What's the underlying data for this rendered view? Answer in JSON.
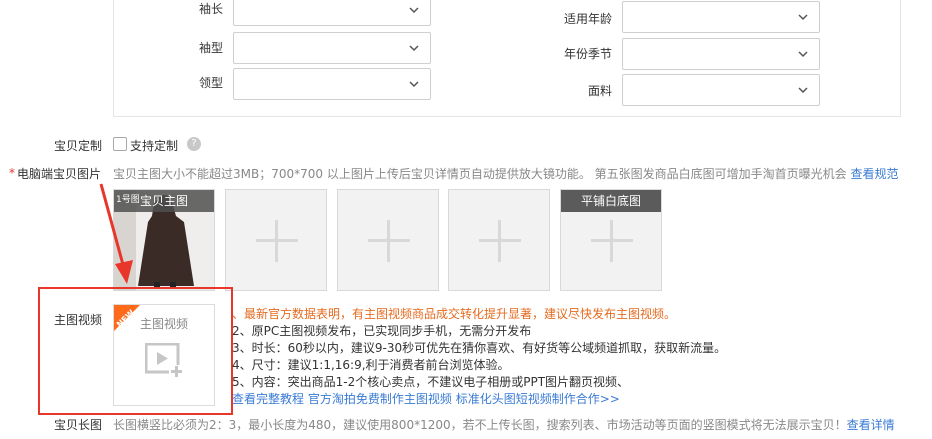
{
  "attributes": {
    "left": [
      {
        "label": "袖长",
        "value": ""
      },
      {
        "label": "袖型",
        "value": ""
      },
      {
        "label": "领型",
        "value": ""
      }
    ],
    "right": [
      {
        "label": "适用年龄",
        "value": ""
      },
      {
        "label": "年份季节",
        "value": ""
      },
      {
        "label": "面料",
        "value": ""
      }
    ]
  },
  "customize": {
    "label": "宝贝定制",
    "checkbox_label": "支持定制",
    "help_icon": "question-icon"
  },
  "main_images": {
    "required_mark": "*",
    "label": "电脑端宝贝图片",
    "hint": "宝贝主图大小不能超过3MB；700*700 以上图片上传后宝贝详情页自动提供放大镜功能。 第五张图发商品白底图可增加手淘首页曝光机会",
    "hint_link": "查看规范",
    "first_slot_title": "宝贝主图",
    "first_slot_tag": "1号图",
    "last_slot_title": "平铺白底图"
  },
  "video": {
    "label": "主图视频",
    "card_title": "主图视频",
    "new_badge": "NEW",
    "items": [
      "、最新官方数据表明，有主图视频商品成交转化提升显著，建议尽快发布主图视频。",
      "2、原PC主图视频发布，已实现同步手机，无需分开发布",
      "3、时长：60秒以内，建议9-30秒可优先在猜你喜欢、有好货等公域频道抓取，获取新流量。",
      "4、尺寸：建议1:1,16:9,利于消费者前台浏览体验。",
      "5、内容：突出商品1-2个核心卖点，不建议电子相册或PPT图片翻页视频、"
    ],
    "links": [
      "查看完整教程",
      "官方淘拍免费制作主图视频",
      "标准化头图短视频制作合作>>"
    ]
  },
  "long_image": {
    "label": "宝贝长图",
    "hint": "长图横竖比必须为2：3，最小长度为480，建议使用800*1200，若不上传长图，搜索列表、市场活动等页面的竖图模式将无法展示宝贝！",
    "link": "查看详情"
  },
  "colors": {
    "annotation_red": "#e8362b",
    "link_blue": "#3a7bd5",
    "warning_orange": "#e56b1f"
  }
}
